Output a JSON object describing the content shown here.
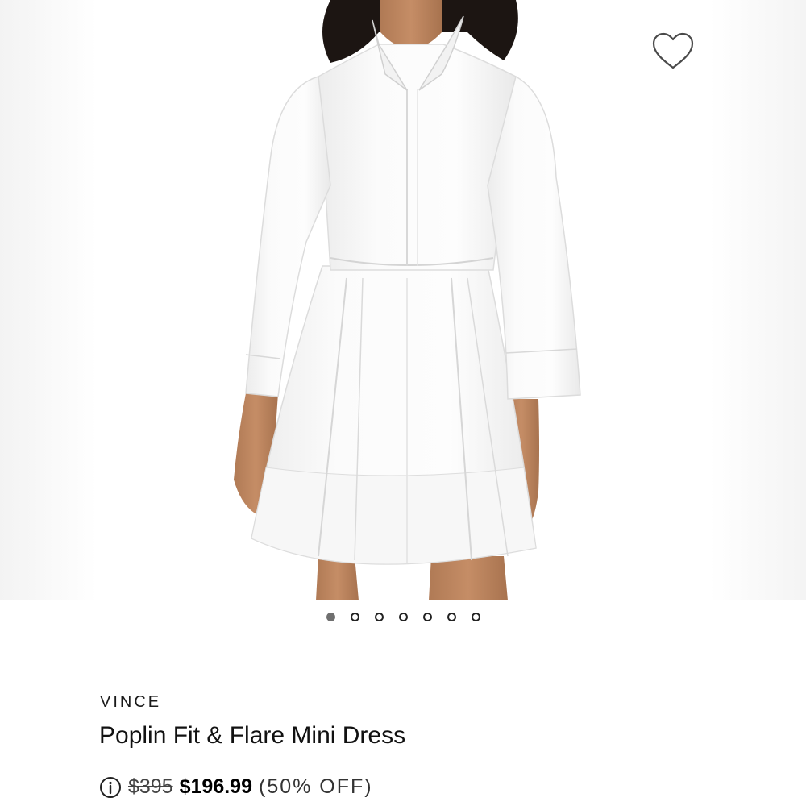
{
  "product": {
    "brand": "VINCE",
    "name": "Poplin Fit & Flare Mini Dress",
    "original_price": "$395",
    "sale_price": "$196.99",
    "discount": "(50% OFF)"
  },
  "gallery": {
    "total_images": 7,
    "active_index": 0
  },
  "icons": {
    "wishlist": "heart-outline-icon",
    "price_info": "info-circle-icon"
  },
  "colors": {
    "text_primary": "#111111",
    "dot_active": "#6f6f6f",
    "background": "#ffffff"
  }
}
